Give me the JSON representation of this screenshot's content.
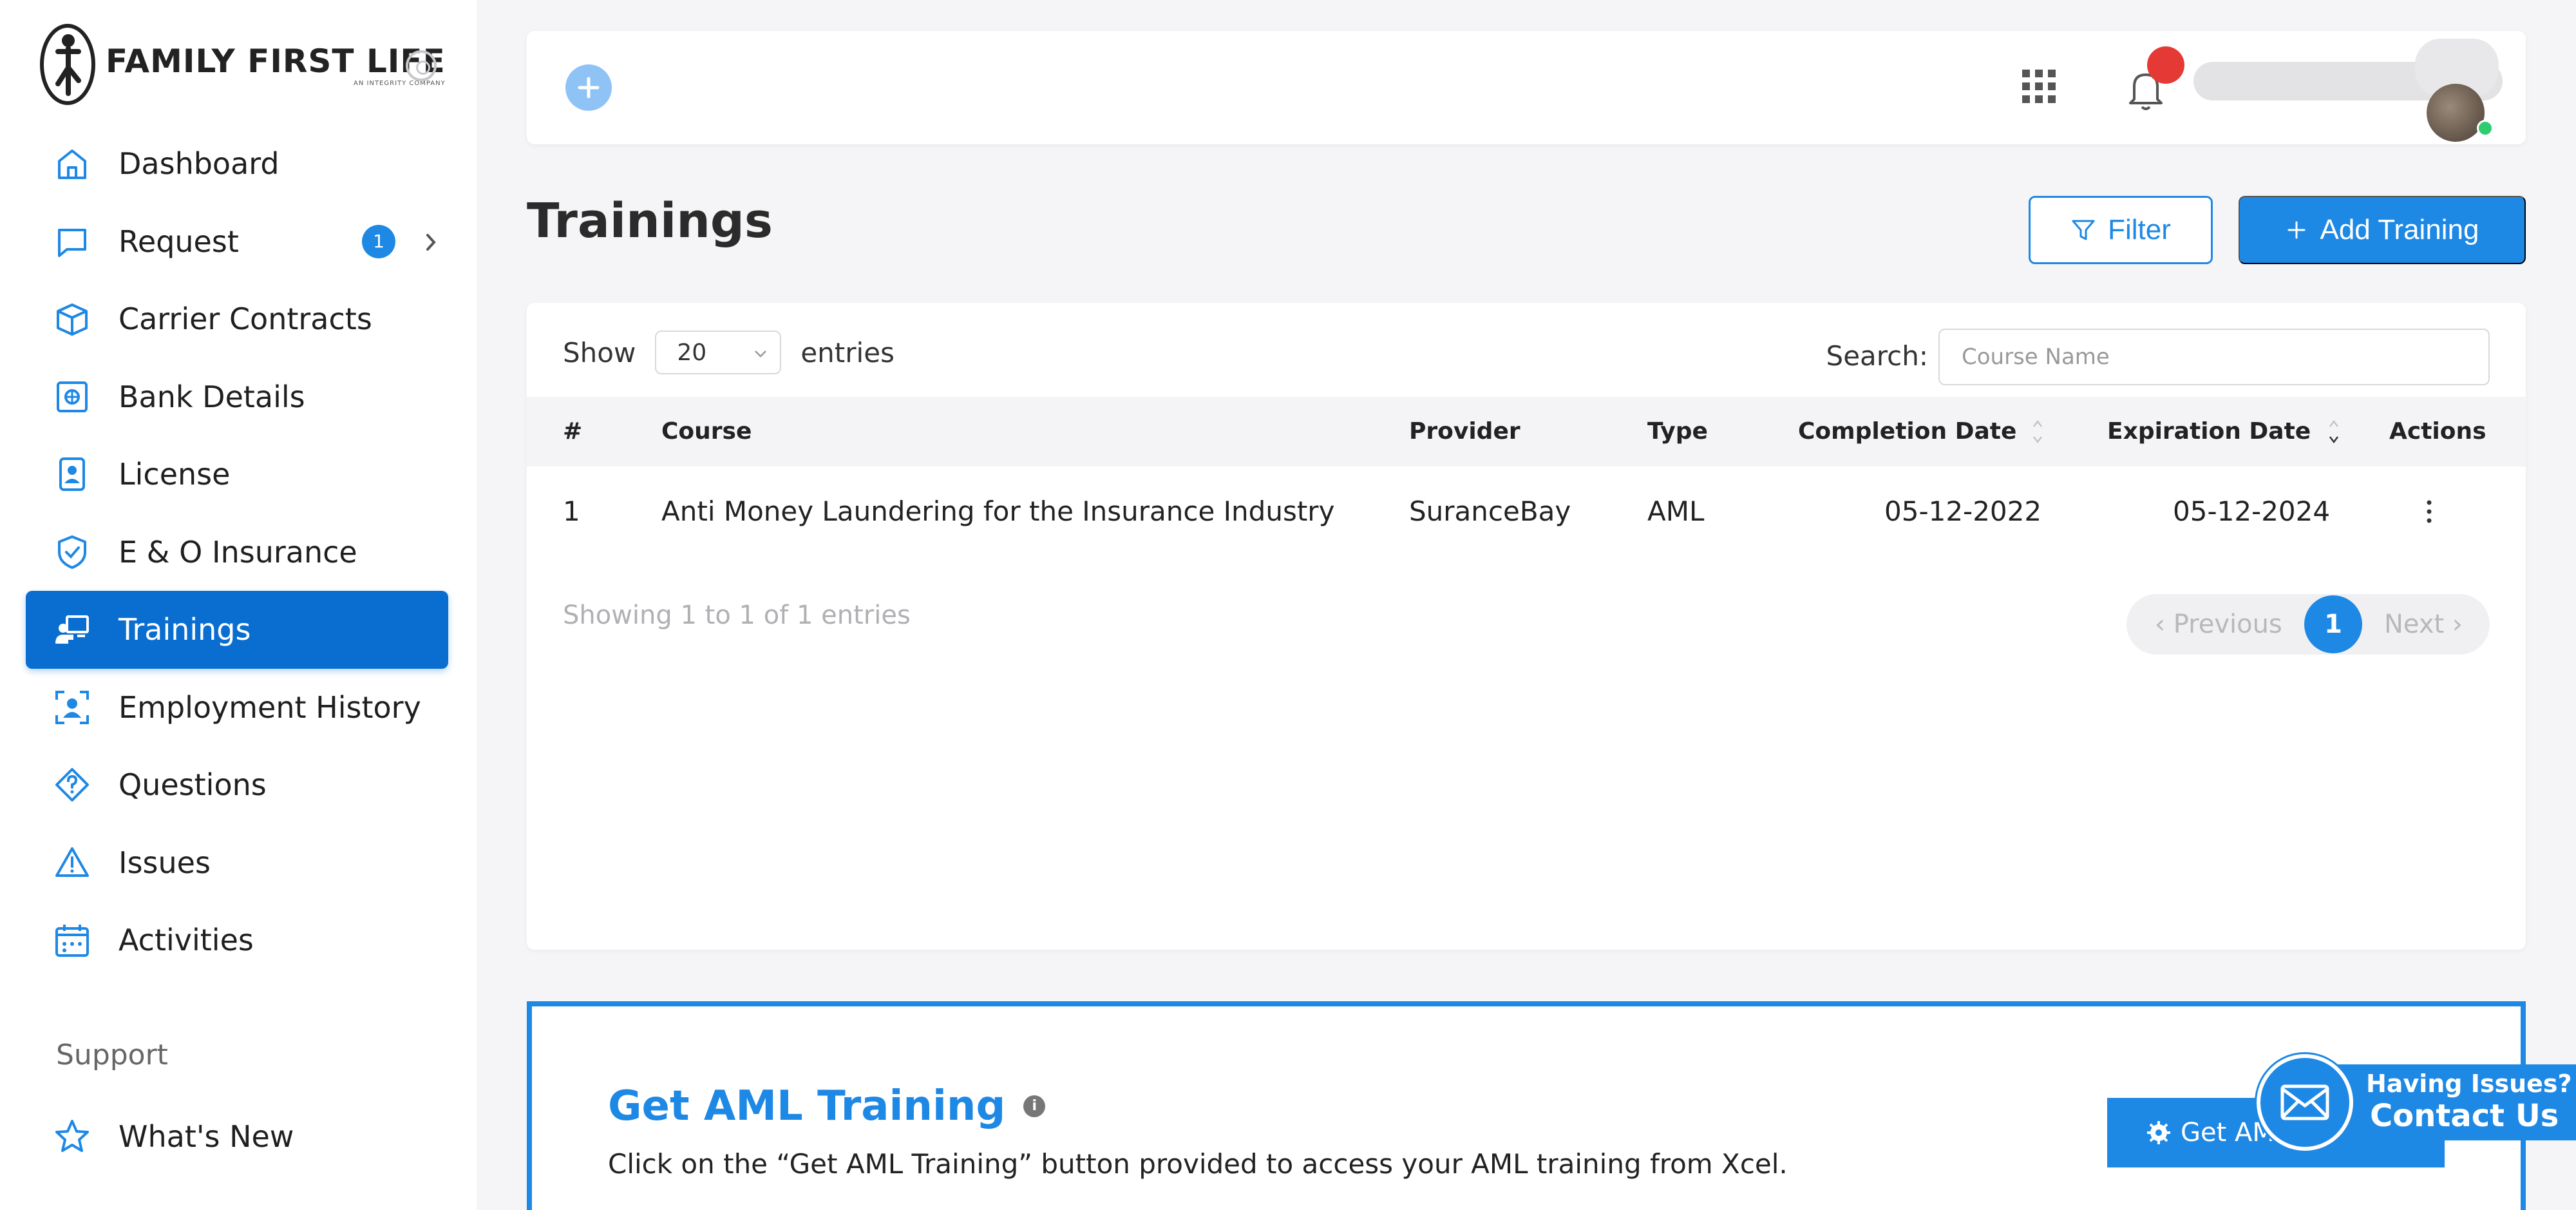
{
  "brand": {
    "name": "FAMILY FIRST LIFE",
    "tagline": "AN INTEGRITY COMPANY",
    "accent": "#1e88e5",
    "active": "#0a6ed1"
  },
  "sidebar": {
    "items": [
      {
        "label": "Dashboard",
        "icon": "home-icon"
      },
      {
        "label": "Request",
        "icon": "chat-icon",
        "badge": "1"
      },
      {
        "label": "Carrier Contracts",
        "icon": "box-icon"
      },
      {
        "label": "Bank Details",
        "icon": "safe-icon"
      },
      {
        "label": "License",
        "icon": "id-badge-icon"
      },
      {
        "label": "E & O Insurance",
        "icon": "shield-check-icon"
      },
      {
        "label": "Trainings",
        "icon": "training-icon",
        "active": true
      },
      {
        "label": "Employment History",
        "icon": "user-frame-icon"
      },
      {
        "label": "Questions",
        "icon": "question-icon"
      },
      {
        "label": "Issues",
        "icon": "warning-icon"
      },
      {
        "label": "Activities",
        "icon": "calendar-icon"
      }
    ],
    "support_label": "Support",
    "support_items": [
      {
        "label": "What's New",
        "icon": "star-icon"
      }
    ]
  },
  "page": {
    "title": "Trainings",
    "filter_label": "Filter",
    "add_label": "Add Training"
  },
  "table": {
    "show_label": "Show",
    "entries_value": "20",
    "entries_label": "entries",
    "search_label": "Search:",
    "search_placeholder": "Course Name",
    "columns": [
      "#",
      "Course",
      "Provider",
      "Type",
      "Completion Date",
      "Expiration Date",
      "Actions"
    ],
    "rows": [
      {
        "num": "1",
        "course": "Anti Money Laundering for the Insurance Industry",
        "provider": "SuranceBay",
        "type": "AML",
        "completion": "05-12-2022",
        "expiration": "05-12-2024"
      }
    ],
    "showing": "Showing 1 to 1 of 1 entries",
    "prev": "Previous",
    "page": "1",
    "next": "Next"
  },
  "aml": {
    "title": "Get AML Training",
    "info": "i",
    "description": "Click on the “Get AML Training” button provided to access your AML training from Xcel.",
    "button": "Get AML"
  },
  "contact": {
    "line1": "Having Issues?",
    "line2": "Contact Us"
  }
}
